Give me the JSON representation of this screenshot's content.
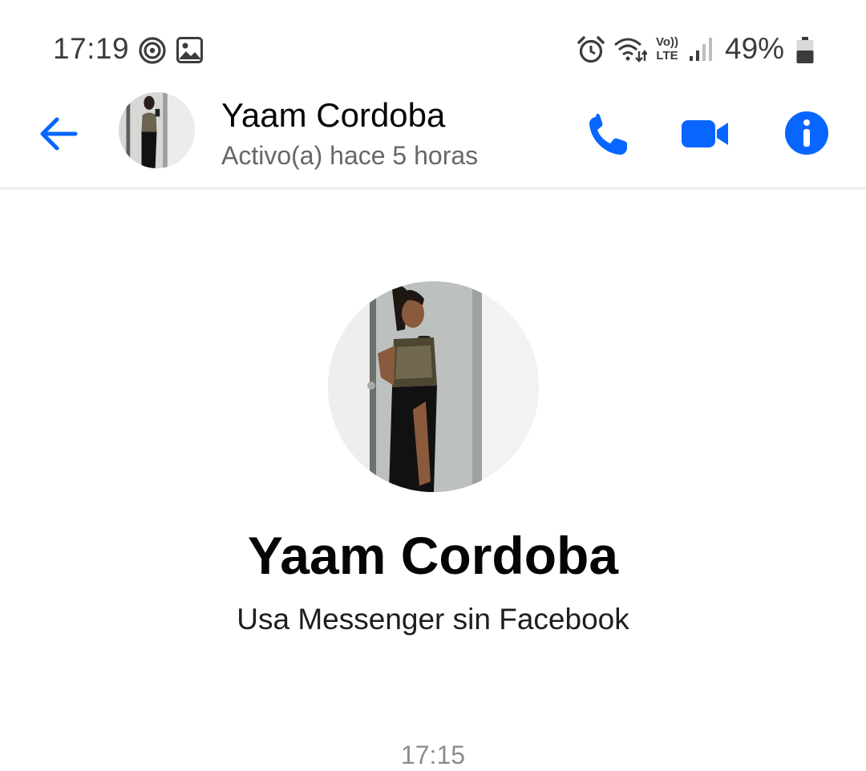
{
  "status_bar": {
    "time": "17:19",
    "battery": "49%",
    "network_label_top": "Vo))",
    "network_label_bottom": "LTE",
    "icons": [
      "focus-icon",
      "image-icon",
      "alarm-icon",
      "wifi-icon",
      "volte-icon",
      "signal-icon",
      "battery-icon"
    ]
  },
  "header": {
    "contact_name": "Yaam Cordoba",
    "contact_status": "Activo(a) hace 5 horas",
    "icons": [
      "back-arrow-icon",
      "phone-icon",
      "video-camera-icon",
      "info-icon"
    ]
  },
  "profile": {
    "name": "Yaam Cordoba",
    "subtitle": "Usa Messenger sin Facebook"
  },
  "conversation": {
    "timestamp": "17:15"
  },
  "colors": {
    "accent": "#0866ff",
    "text_primary": "#050505",
    "text_secondary": "#65676b",
    "timestamp": "#8a8d91",
    "status_bar_text": "#3c3c3c"
  }
}
